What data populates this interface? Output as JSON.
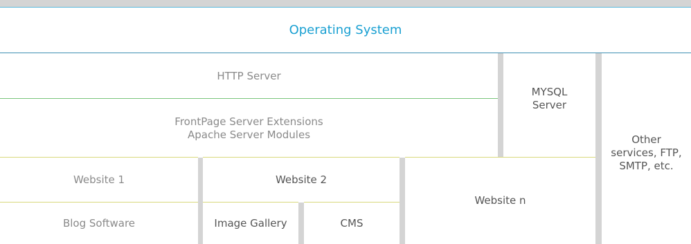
{
  "diagram": {
    "os": "Operating System",
    "http_server": "HTTP Server",
    "extensions": "FrontPage Server Extensions\nApache Server Modules",
    "mysql": "MYSQL\nServer",
    "other": "Other\nservices, FTP,\nSMTP, etc.",
    "website1": "Website 1",
    "website2": "Website 2",
    "website_n": "Website n",
    "blog": "Blog Software",
    "gallery": "Image Gallery",
    "cms": "CMS"
  },
  "colors": {
    "accent": "#1aa0d2",
    "green_rule": "#78c47a",
    "yellow_rule": "#d9d97c",
    "gap": "#d4d4d4"
  }
}
